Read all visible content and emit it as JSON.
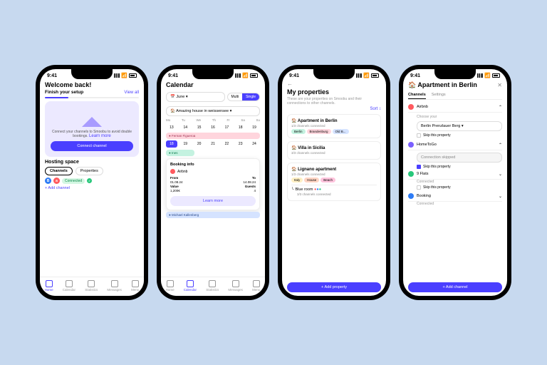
{
  "status_time": "9:41",
  "s1": {
    "welcome": "Welcome back!",
    "setup": "Finish your setup",
    "viewall": "View all",
    "card_text": "Connect your channels to Smoobu to avoid double bookings.",
    "learn": "Learn more",
    "connect": "Connect channel",
    "hosting": "Hosting space",
    "tab1": "Channels",
    "tab2": "Properties",
    "connected": "Connected",
    "addch": "+ Add channel"
  },
  "s2": {
    "title": "Calendar",
    "month": "June",
    "multi": "Multi",
    "single": "Single",
    "house": "Amazing house in weissensee",
    "days": [
      "Mo",
      "Tu",
      "We",
      "Th",
      "Fr",
      "Sa",
      "Su"
    ],
    "nums": [
      "13",
      "14",
      "15",
      "16",
      "17",
      "18",
      "19"
    ],
    "ev1": "Fernan Figueroa",
    "ev2": "Ines",
    "popup": {
      "title": "Booking info",
      "ch": "Airbnb",
      "from_l": "From",
      "from": "01.08.24",
      "to_l": "To",
      "to": "14.08.24",
      "val_l": "Value",
      "val": "1,200€",
      "g_l": "Guests",
      "g": "4",
      "btn": "Learn more"
    },
    "ev3": "Michael Kallenberg"
  },
  "s3": {
    "title": "My properties",
    "sub": "These are your properties on Smoobu and their connections to other channels.",
    "sort": "Sort",
    "p1": {
      "name": "Apartment in Berlin",
      "sub": "1/3 channels connected",
      "c": [
        "Berlin",
        "Brandenburg",
        "Old B..."
      ]
    },
    "p2": {
      "name": "Villa in Sicilia",
      "sub": "3/3 channels connected"
    },
    "p3": {
      "name": "Lignano apartment",
      "sub": "1/3 channels connected",
      "c": [
        "Italy",
        "House",
        "Beach"
      ],
      "room": "Blue room",
      "roomsub": "3/3 channels connected"
    },
    "btn": "+   Add property"
  },
  "s4": {
    "title": "Apartment in Berlin",
    "tab1": "Channels",
    "tab2": "Settings",
    "ch1": "Airbnb",
    "hint": "Choose your",
    "val": "Berlin Prenzlauer Berg",
    "skip": "Skip this property",
    "ch2": "HomeToGo",
    "st2": "Connection skipped",
    "ch3": "9 Flats",
    "st3": "Connected",
    "ch4": "Booking",
    "st4": "Connected",
    "btn": "+   Add channel"
  },
  "nav": [
    "Home",
    "Calendar",
    "Statistics",
    "Messages",
    "Menu"
  ]
}
